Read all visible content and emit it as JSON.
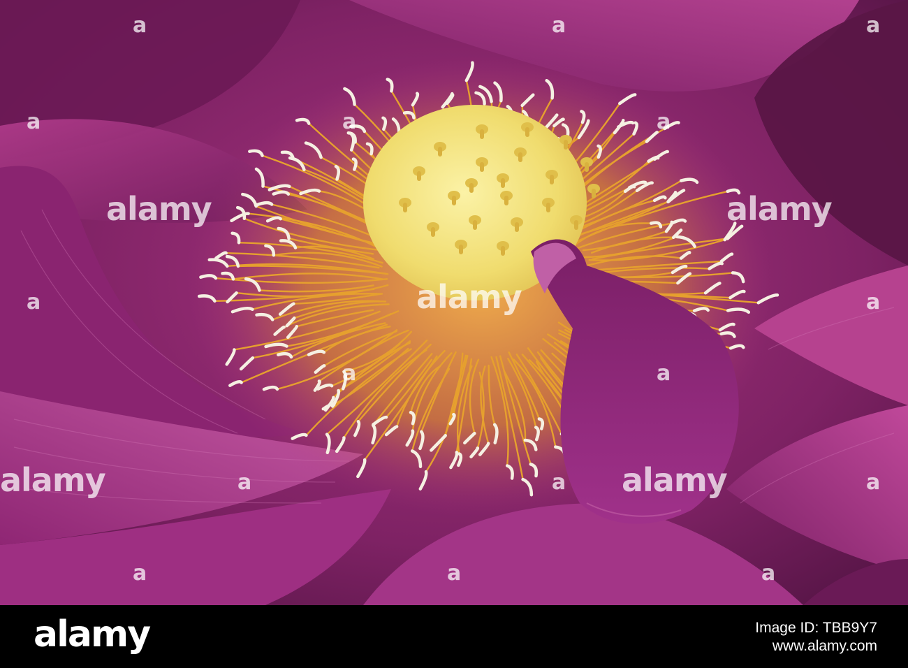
{
  "watermark": {
    "text": "alamy",
    "mark": "a"
  },
  "footer": {
    "logo": "alamy",
    "image_id_label": "Image ID:",
    "image_id": "TBB9Y7",
    "url": "www.alamy.com"
  },
  "colors": {
    "petal": "#9a2a7c",
    "petal_dark": "#5a1646",
    "receptacle": "#f3e07a",
    "stamen": "#e8a22a",
    "anther": "#f4efe0"
  }
}
